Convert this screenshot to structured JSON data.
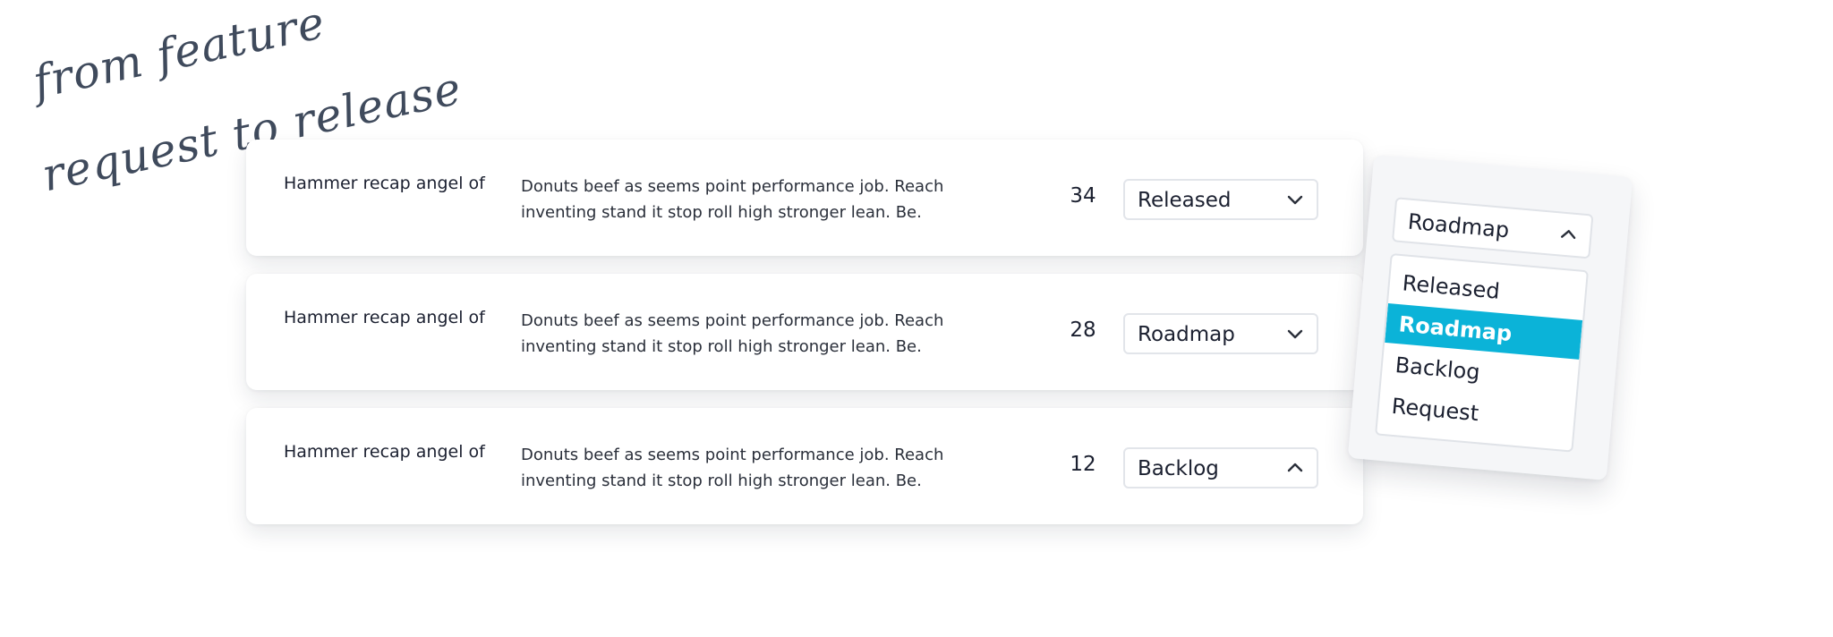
{
  "caption": {
    "line1": "from feature",
    "line2": "request to release"
  },
  "rows": [
    {
      "title": "Hammer recap angel of",
      "description": "Donuts beef as seems point performance job. Reach inventing stand it stop roll high stronger lean. Be.",
      "count": "34",
      "status": "Released",
      "chevron": "chevron-down-icon"
    },
    {
      "title": "Hammer recap angel of",
      "description": "Donuts beef as seems point performance job. Reach inventing stand it stop roll high stronger lean. Be.",
      "count": "28",
      "status": "Roadmap",
      "chevron": "chevron-down-icon"
    },
    {
      "title": "Hammer recap angel of",
      "description": "Donuts beef as seems point performance job. Reach inventing stand it stop roll high stronger lean. Be.",
      "count": "12",
      "status": "Backlog",
      "chevron": "chevron-up-icon"
    }
  ],
  "dropdown": {
    "current": "Roadmap",
    "chevron": "chevron-up-icon",
    "options": [
      "Released",
      "Roadmap",
      "Backlog",
      "Request"
    ],
    "selected_option": "Roadmap",
    "highlight_color": "#0bb3d8"
  }
}
